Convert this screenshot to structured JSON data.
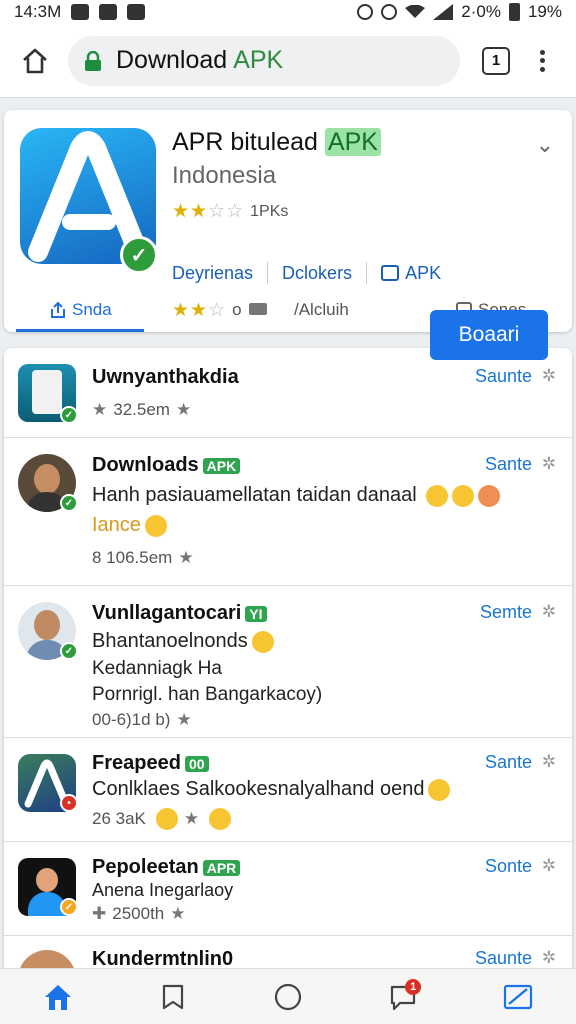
{
  "status_bar": {
    "time": "14:3M",
    "battery_text": "2·0%",
    "battery_pct": "19%"
  },
  "browser": {
    "url_main": "Download",
    "url_highlight": "APK",
    "tabs_count": "1"
  },
  "app": {
    "title_main": "APR bitulead",
    "title_tag": "APK",
    "subtitle": "Indonesia",
    "rating_text": "1PKs",
    "links": [
      {
        "label": "Deyrienas"
      },
      {
        "label": "Dclokers"
      },
      {
        "label": "APK"
      }
    ],
    "tabs": [
      {
        "label": "Snda"
      },
      {
        "label": "o"
      },
      {
        "label": "/Alcluih"
      },
      {
        "label": "Sones"
      }
    ]
  },
  "feed": [
    {
      "title": "Uwnyanthakdia",
      "tag": "",
      "lines": [],
      "meta": "32.5em",
      "action": "Saunte"
    },
    {
      "title": "Downloads",
      "tag": "APK",
      "lines": [
        "Hanh pasiauamellatan taidan danaal",
        "Iance"
      ],
      "meta": "8 106.5em",
      "action": "Sante"
    },
    {
      "title": "Vunllagantocari",
      "tag": "YI",
      "lines": [
        "Bhantanoelnonds",
        "Kedanniagk Ha",
        "Pornrigl. han Bangarkacoy)"
      ],
      "meta": "00-6)1d b)",
      "action": "Semte"
    },
    {
      "title": "Freapeed",
      "tag": "00",
      "lines": [
        "Conlklaes Salkookesnalyalhand oend"
      ],
      "meta": "26 3aK",
      "action": "Sante"
    },
    {
      "title": "Pepoleetan",
      "tag": "APR",
      "lines": [
        "Anena Inegarlaoy"
      ],
      "meta": "2500th",
      "action": "Sonte"
    },
    {
      "title": "Kundermtnlin0",
      "tag": "",
      "lines": [],
      "meta": "",
      "action": "Saunte"
    }
  ],
  "boost_button": "Boaari",
  "bottom_nav": {
    "notification_count": "1"
  }
}
